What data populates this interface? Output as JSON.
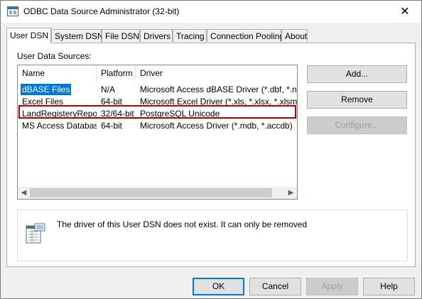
{
  "window": {
    "title": "ODBC Data Source Administrator (32-bit)",
    "close_glyph": "✕"
  },
  "tabs": [
    {
      "label": "User DSN",
      "active": true
    },
    {
      "label": "System DSN",
      "active": false
    },
    {
      "label": "File DSN",
      "active": false
    },
    {
      "label": "Drivers",
      "active": false
    },
    {
      "label": "Tracing",
      "active": false
    },
    {
      "label": "Connection Pooling",
      "active": false
    },
    {
      "label": "About",
      "active": false
    }
  ],
  "panel": {
    "section_label": "User Data Sources:",
    "columns": [
      "Name",
      "Platform",
      "Driver"
    ],
    "rows": [
      {
        "name": "dBASE Files",
        "platform": "N/A",
        "driver": "Microsoft Access dBASE Driver (*.dbf, *.ndx, *.mdx)"
      },
      {
        "name": "Excel Files",
        "platform": "64-bit",
        "driver": "Microsoft Excel Driver (*.xls, *.xlsx, *.xlsm, *.xlsb)"
      },
      {
        "name": "LandRegisteryReport",
        "platform": "32/64-bit",
        "driver": "PostgreSQL Unicode"
      },
      {
        "name": "MS Access Database",
        "platform": "64-bit",
        "driver": "Microsoft Access Driver (*.mdb, *.accdb)"
      }
    ],
    "selected_row": "dBASE Files",
    "highlighted_row": "LandRegisteryReport",
    "buttons": {
      "add": "Add...",
      "remove": "Remove",
      "configure": "Configure..."
    },
    "info_text": "The driver of this User DSN does not exist. It can only be removed"
  },
  "footer": {
    "ok": "OK",
    "cancel": "Cancel",
    "apply": "Apply",
    "help": "Help"
  },
  "colors": {
    "selection": "#0078d7",
    "highlight_border": "#b00000"
  }
}
